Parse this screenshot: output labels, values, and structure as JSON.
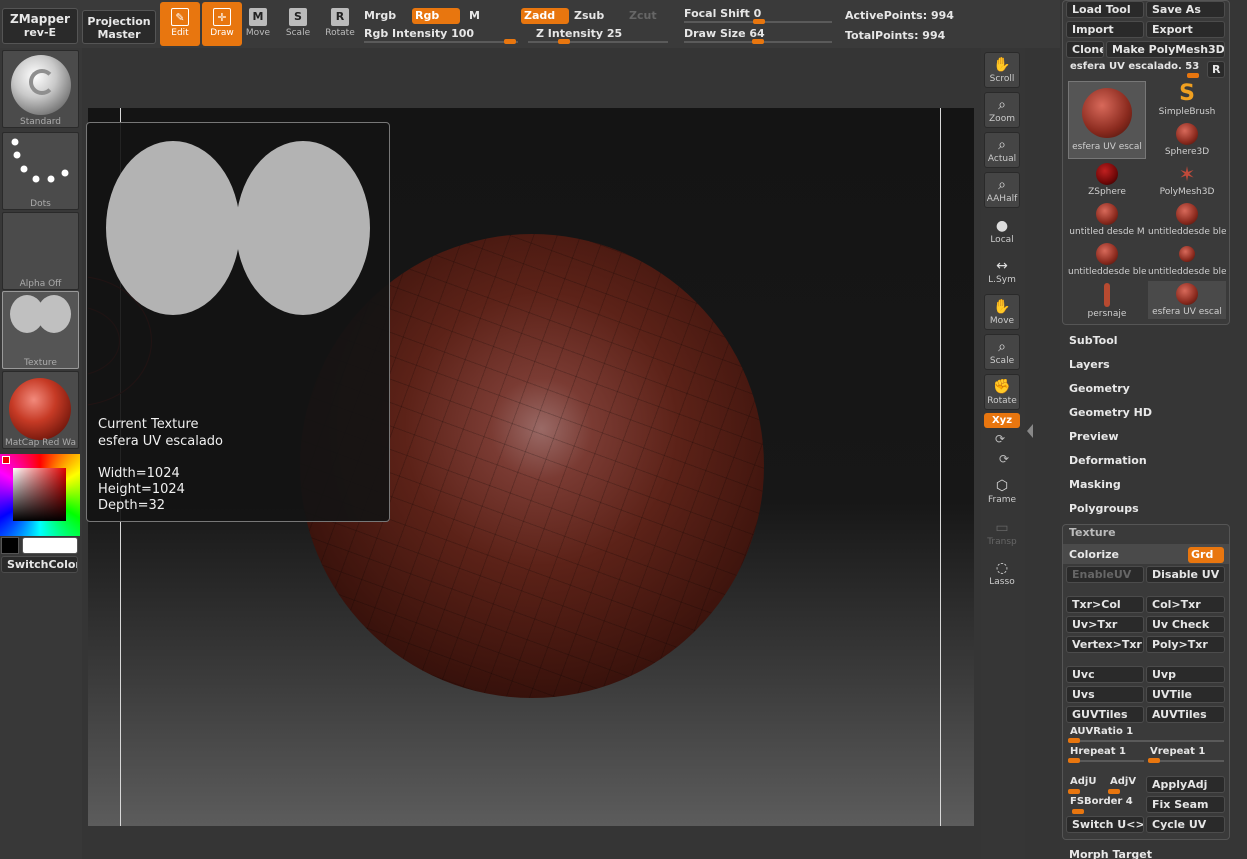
{
  "topbar": {
    "zmapper": {
      "line1": "ZMapper",
      "line2": "rev-E"
    },
    "projection": {
      "line1": "Projection",
      "line2": "Master"
    },
    "tools": [
      {
        "label": "Edit",
        "glyph": "✎"
      },
      {
        "label": "Draw",
        "glyph": "✛"
      },
      {
        "label": "Move",
        "glyph": "M"
      },
      {
        "label": "Scale",
        "glyph": "S"
      },
      {
        "label": "Rotate",
        "glyph": "R"
      }
    ],
    "mrgb": "Mrgb",
    "rgb": "Rgb",
    "m": "M",
    "rgb_intensity": "Rgb Intensity 100",
    "zadd": "Zadd",
    "zsub": "Zsub",
    "zcut": "Zcut",
    "z_intensity": "Z Intensity 25",
    "focal_shift": "Focal Shift 0",
    "draw_size": "Draw Size 64",
    "active_points": "ActivePoints: 994",
    "total_points": "TotalPoints: 994",
    "accent_color": "#e8760f"
  },
  "left_shelf": {
    "brush": "Standard",
    "stroke": "Dots",
    "alpha": "Alpha Off",
    "texture": "Texture",
    "material": "MatCap Red Wa",
    "switch_color": "SwitchColor"
  },
  "texture_popup": {
    "title": "Current Texture",
    "name": "esfera UV escalado",
    "width": "Width=1024",
    "height": "Height=1024",
    "depth": "Depth=32"
  },
  "right_tools": {
    "scroll": "Scroll",
    "zoom": "Zoom",
    "actual": "Actual",
    "aahalf": "AAHalf",
    "local": "Local",
    "lsym": "L.Sym",
    "move": "Move",
    "scale": "Scale",
    "rotate": "Rotate",
    "xyz": "Xyz",
    "frame": "Frame",
    "transp": "Transp",
    "lasso": "Lasso"
  },
  "panel": {
    "load_tool": "Load Tool",
    "save_as": "Save As",
    "import": "Import",
    "export": "Export",
    "clone": "Clone",
    "make_polymesh": "Make PolyMesh3D",
    "current_tool": "esfera UV escalado. 53",
    "r": "R",
    "tools": [
      {
        "name": "esfera UV escal"
      },
      {
        "name": "SimpleBrush"
      },
      {
        "name": "Sphere3D"
      },
      {
        "name": "ZSphere"
      },
      {
        "name": "PolyMesh3D"
      },
      {
        "name": "untitled desde M"
      },
      {
        "name": "untitleddesde bler"
      },
      {
        "name": "untitleddesde bler"
      },
      {
        "name": "untitleddesde bler"
      },
      {
        "name": "persnaje"
      },
      {
        "name": "esfera UV escal"
      }
    ],
    "sections": [
      "SubTool",
      "Layers",
      "Geometry",
      "Geometry HD",
      "Preview",
      "Deformation",
      "Masking",
      "Polygroups"
    ],
    "texture_header": "Texture",
    "colorize": "Colorize",
    "grd": "Grd",
    "enable_uv": "EnableUV",
    "disable_uv": "Disable UV",
    "txr_col": "Txr>Col",
    "col_txr": "Col>Txr",
    "uv_txr": "Uv>Txr",
    "uv_check": "Uv Check",
    "vertex_txr": "Vertex>Txr",
    "poly_txr": "Poly>Txr",
    "uvc": "Uvc",
    "uvp": "Uvp",
    "uvs": "Uvs",
    "uvtile": "UVTile",
    "guvtiles": "GUVTiles",
    "auvtiles": "AUVTiles",
    "auvratio": "AUVRatio 1",
    "hrepeat": "Hrepeat 1",
    "vrepeat": "Vrepeat 1",
    "adju": "AdjU",
    "adjv": "AdjV",
    "applyadj": "ApplyAdj",
    "fsborder": "FSBorder 4",
    "fix_seam": "Fix Seam",
    "switch_uv": "Switch U<>V",
    "cycle_uv": "Cycle UV",
    "morph_target": "Morph Target"
  }
}
